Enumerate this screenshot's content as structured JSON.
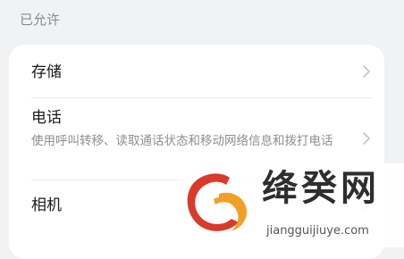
{
  "section": {
    "title": "已允许"
  },
  "permissions": [
    {
      "label": "存储",
      "description": ""
    },
    {
      "label": "电话",
      "description": "使用呼叫转移、读取通话状态和移动网络信息和拨打电话"
    },
    {
      "label": "相机",
      "description": ""
    }
  ],
  "watermark": {
    "brand": "绛癸网",
    "url": "jiangguijiuye.com",
    "colors": {
      "red": "#d93a2b",
      "orange": "#f0a028"
    }
  },
  "icons": {
    "chevron": "chevron-right-icon",
    "logo": "brand-logo-icon"
  }
}
